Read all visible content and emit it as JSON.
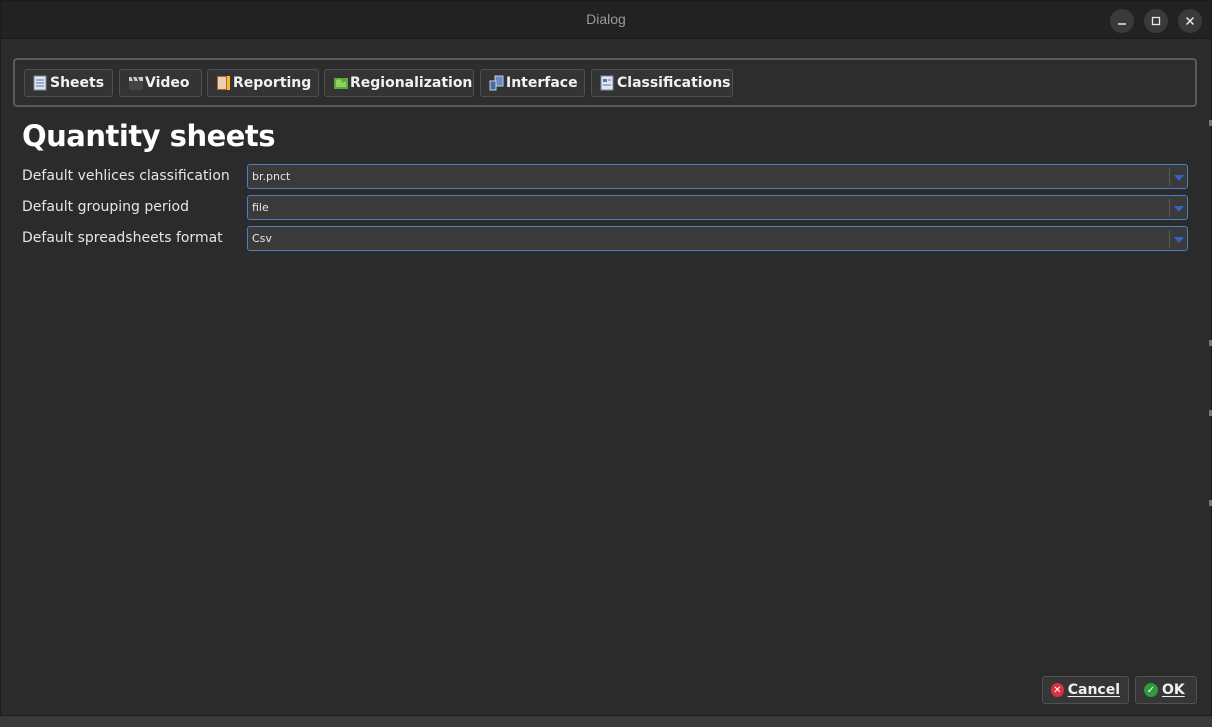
{
  "window": {
    "title": "Dialog",
    "controls": {
      "minimize": "–",
      "maximize": "☐",
      "close": "✕"
    }
  },
  "tabs": [
    {
      "label": "Sheets",
      "icon": "sheet-icon"
    },
    {
      "label": "Video",
      "icon": "clapperboard-icon"
    },
    {
      "label": "Reporting",
      "icon": "report-icon"
    },
    {
      "label": "Regionalization",
      "icon": "map-icon"
    },
    {
      "label": "Interface",
      "icon": "interface-icon"
    },
    {
      "label": "Classifications",
      "icon": "classification-icon"
    }
  ],
  "page": {
    "heading": "Quantity sheets",
    "fields": [
      {
        "label": "Default vehlices classification",
        "value": "br.pnct"
      },
      {
        "label": "Default grouping period",
        "value": "file"
      },
      {
        "label": "Default spreadsheets format",
        "value": "Csv"
      }
    ]
  },
  "buttons": {
    "cancel": "Cancel",
    "ok": "OK"
  },
  "colors": {
    "accent": "#4c7fc0",
    "cancel_icon": "#d8323c",
    "ok_icon": "#2e9a3e"
  }
}
